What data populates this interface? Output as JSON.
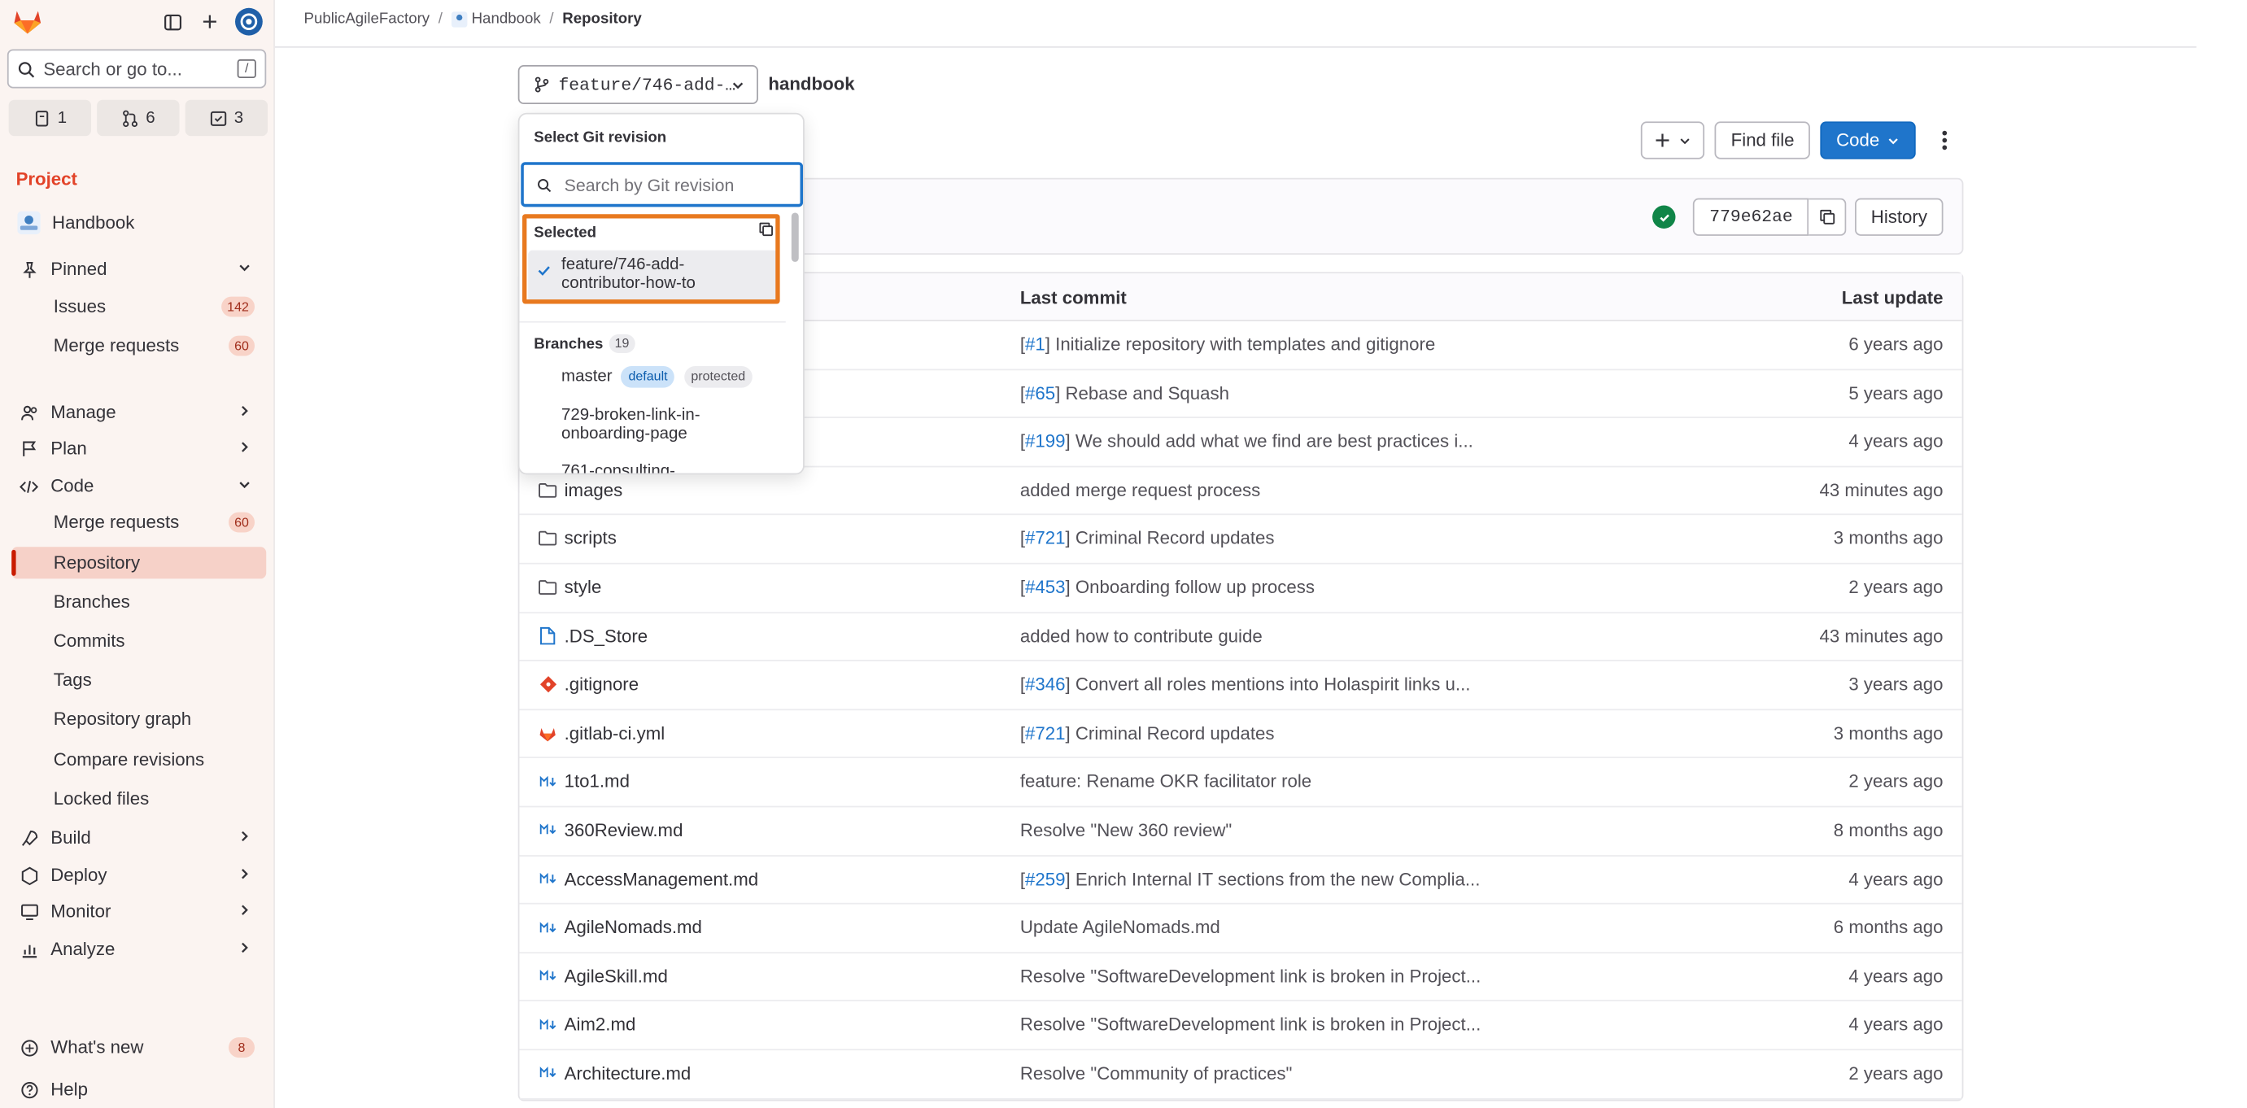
{
  "sidebar": {
    "search_placeholder": "Search or go to...",
    "search_shortcut": "/",
    "counters": [
      {
        "icon": "issues-icon",
        "count": "1"
      },
      {
        "icon": "merge-request-icon",
        "count": "6"
      },
      {
        "icon": "todo-icon",
        "count": "3"
      }
    ],
    "section_title": "Project",
    "project_name": "Handbook",
    "pinned": {
      "label": "Pinned",
      "items": [
        {
          "label": "Issues",
          "count": "142"
        },
        {
          "label": "Merge requests",
          "count": "60"
        }
      ]
    },
    "groups": [
      {
        "label": "Manage"
      },
      {
        "label": "Plan"
      },
      {
        "label": "Code"
      }
    ],
    "code_items": [
      {
        "label": "Merge requests",
        "count": "60"
      },
      {
        "label": "Repository",
        "active": true
      },
      {
        "label": "Branches"
      },
      {
        "label": "Commits"
      },
      {
        "label": "Tags"
      },
      {
        "label": "Repository graph"
      },
      {
        "label": "Compare revisions"
      },
      {
        "label": "Locked files"
      }
    ],
    "bottom_groups": [
      {
        "label": "Build"
      },
      {
        "label": "Deploy"
      },
      {
        "label": "Monitor"
      },
      {
        "label": "Analyze"
      }
    ],
    "whats_new": {
      "label": "What's new",
      "count": "8"
    },
    "help": "Help"
  },
  "breadcrumb": [
    "PublicAgileFactory",
    "Handbook",
    "Repository"
  ],
  "branch_selector": {
    "label": "feature/746-add-…"
  },
  "repo_name": "handbook",
  "toolbar": {
    "find_file": "Find file",
    "code": "Code"
  },
  "commit": {
    "sha": "779e62ae",
    "history": "History"
  },
  "table": {
    "headers": {
      "last_commit": "Last commit",
      "last_update": "Last update"
    },
    "rows": [
      {
        "name": "",
        "icon": "",
        "ref": "#1",
        "msg": "Initialize repository with templates and gitignore",
        "when": "6 years ago"
      },
      {
        "name": "",
        "icon": "",
        "ref": "#65",
        "msg": "Rebase and Squash",
        "when": "5 years ago"
      },
      {
        "name": "",
        "icon": "",
        "ref": "#199",
        "msg": "We should add what we find are best practices i...",
        "when": "4 years ago"
      },
      {
        "name": "images",
        "icon": "folder",
        "ref": "",
        "msg": "added merge request process",
        "when": "43 minutes ago"
      },
      {
        "name": "scripts",
        "icon": "folder",
        "ref": "#721",
        "msg": "Criminal Record updates",
        "when": "3 months ago"
      },
      {
        "name": "style",
        "icon": "folder",
        "ref": "#453",
        "msg": "Onboarding follow up process",
        "when": "2 years ago"
      },
      {
        "name": ".DS_Store",
        "icon": "file",
        "ref": "",
        "msg": "added how to contribute guide",
        "when": "43 minutes ago"
      },
      {
        "name": ".gitignore",
        "icon": "git",
        "ref": "#346",
        "msg": "Convert all roles mentions into Holaspirit links u...",
        "when": "3 years ago"
      },
      {
        "name": ".gitlab-ci.yml",
        "icon": "gitlab",
        "ref": "#721",
        "msg": "Criminal Record updates",
        "when": "3 months ago"
      },
      {
        "name": "1to1.md",
        "icon": "md",
        "ref": "",
        "msg": "feature: Rename OKR facilitator role",
        "when": "2 years ago"
      },
      {
        "name": "360Review.md",
        "icon": "md",
        "ref": "",
        "msg": "Resolve \"New 360 review\"",
        "when": "8 months ago"
      },
      {
        "name": "AccessManagement.md",
        "icon": "md",
        "ref": "#259",
        "msg": "Enrich Internal IT sections from the new Complia...",
        "when": "4 years ago"
      },
      {
        "name": "AgileNomads.md",
        "icon": "md",
        "ref": "",
        "msg": "Update AgileNomads.md",
        "when": "6 months ago"
      },
      {
        "name": "AgileSkill.md",
        "icon": "md",
        "ref": "",
        "msg": "Resolve \"SoftwareDevelopment link is broken in Project...",
        "when": "4 years ago"
      },
      {
        "name": "Aim2.md",
        "icon": "md",
        "ref": "",
        "msg": "Resolve \"SoftwareDevelopment link is broken in Project...",
        "when": "4 years ago"
      },
      {
        "name": "Architecture.md",
        "icon": "md",
        "ref": "",
        "msg": "Resolve \"Community of practices\"",
        "when": "2 years ago"
      }
    ]
  },
  "dropdown": {
    "title": "Select Git revision",
    "search_placeholder": "Search by Git revision",
    "selected_heading": "Selected",
    "selected_item": "feature/746-add-contributor-how-to",
    "branches_heading": "Branches",
    "branches_count": "19",
    "branches": [
      {
        "name": "master",
        "tags": [
          "default",
          "protected"
        ]
      },
      {
        "name": "729-broken-link-in-onboarding-page",
        "tags": []
      },
      {
        "name": "761-consulting-",
        "tags": []
      }
    ]
  },
  "colors": {
    "accent": "#1f75cb",
    "brand": "#e24329",
    "highlight": "#e8791f",
    "sidebar_bg": "#fbf4f1",
    "active_bg": "#f6d1c8"
  }
}
